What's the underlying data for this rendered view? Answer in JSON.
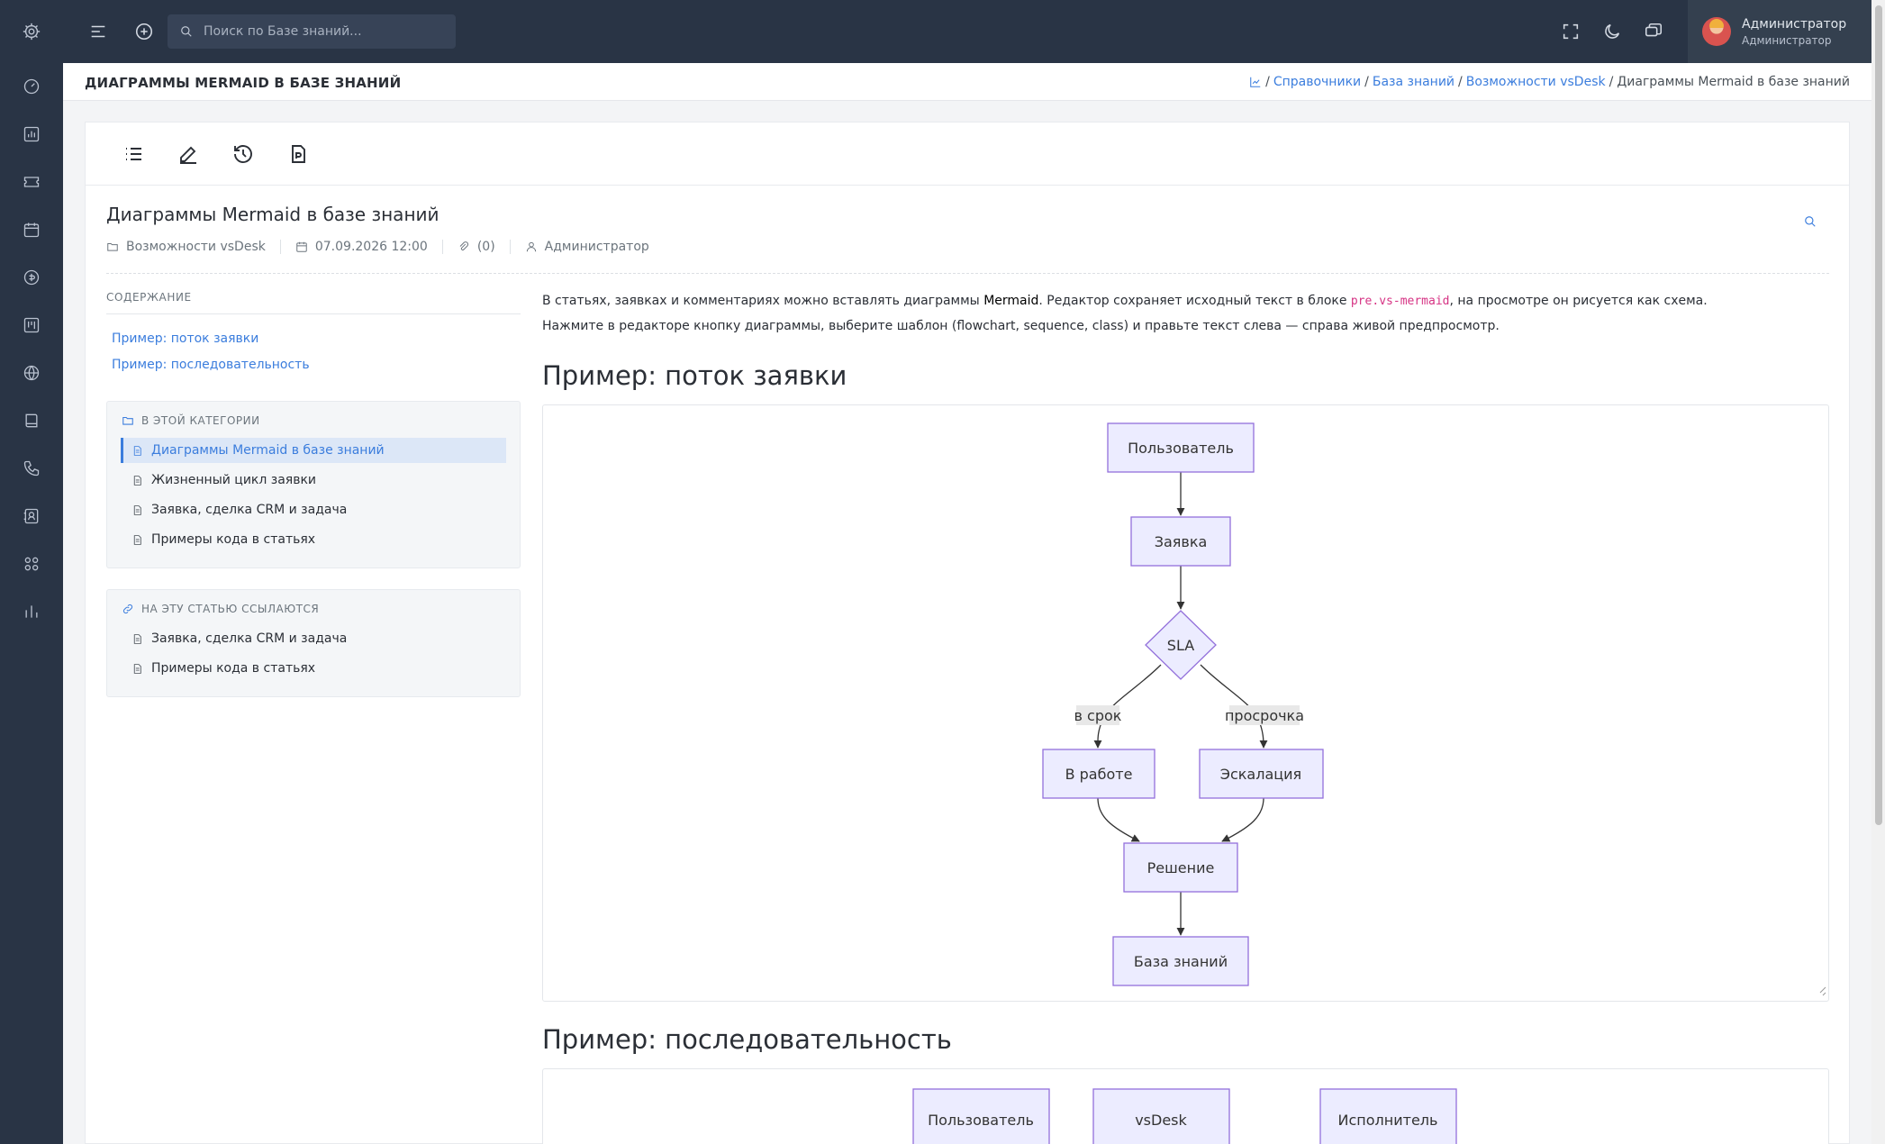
{
  "topbar": {
    "search_placeholder": "Поиск по Базе знаний...",
    "user_name": "Администратор",
    "user_role": "Администратор"
  },
  "page_header": {
    "title": "ДИАГРАММЫ MERMAID В БАЗЕ ЗНАНИЙ",
    "breadcrumb": [
      {
        "label": "Справочники"
      },
      {
        "label": "База знаний"
      },
      {
        "label": "Возможности vsDesk"
      },
      {
        "label": "Диаграммы Mermaid в базе знаний"
      }
    ],
    "separator": "/"
  },
  "article": {
    "title": "Диаграммы Mermaid в базе знаний",
    "meta": {
      "category": "Возможности vsDesk",
      "date": "07.09.2026 12:00",
      "attachments": "(0)",
      "author": "Администратор"
    }
  },
  "toc": {
    "title": "СОДЕРЖАНИЕ",
    "links": [
      "Пример: поток заявки",
      "Пример: последовательность"
    ]
  },
  "category_box": {
    "title": "В ЭТОЙ КАТЕГОРИИ",
    "items": [
      "Диаграммы Mermaid в базе знаний",
      "Жизненный цикл заявки",
      "Заявка, сделка CRM и задача",
      "Примеры кода в статьях"
    ]
  },
  "refs_box": {
    "title": "НА ЭТУ СТАТЬЮ ССЫЛАЮТСЯ",
    "items": [
      "Заявка, сделка CRM и задача",
      "Примеры кода в статьях"
    ]
  },
  "content": {
    "p1_a": "В статьях, заявках и комментариях можно вставлять диаграммы ",
    "p1_b": "Mermaid",
    "p1_c": ". Редактор сохраняет исходный текст в блоке ",
    "p1_code": "pre.vs-mermaid",
    "p1_d": ", на просмотре он рисуется как схема.",
    "p2": "Нажмите в редакторе кнопку диаграммы, выберите шаблон (flowchart, sequence, class) и правьте текст слева — справа живой предпросмотр.",
    "h2_flow": "Пример: поток заявки",
    "h2_seq": "Пример: последовательность"
  },
  "flowchart": {
    "nodes": {
      "user": "Пользователь",
      "ticket": "Заявка",
      "sla": "SLA",
      "work": "В работе",
      "escalation": "Эскалация",
      "solution": "Решение",
      "kb": "База знаний"
    },
    "edge_labels": {
      "on_time": "в срок",
      "overdue": "просрочка"
    }
  },
  "sequence": {
    "actors": [
      "Пользователь",
      "vsDesk",
      "Исполнитель"
    ]
  },
  "colors": {
    "sidebar_bg": "#293445",
    "accent": "#3b7ddd",
    "node_fill": "#ececff",
    "node_stroke": "#9370db"
  }
}
